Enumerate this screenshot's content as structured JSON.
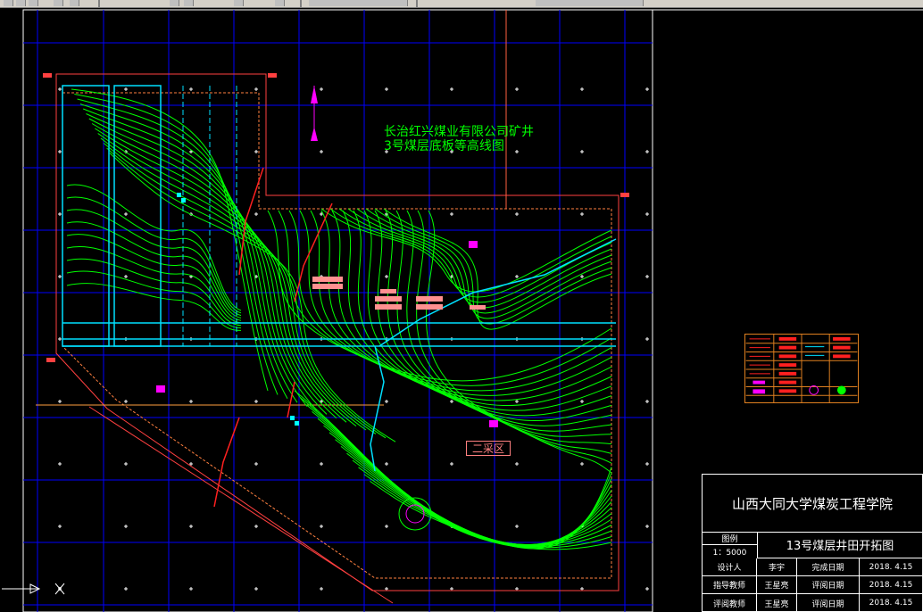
{
  "toolbar": {
    "buttons": [
      "new-icon",
      "open-icon",
      "save-icon",
      "undo-icon",
      "redo-icon",
      "pan-icon",
      "zoom-icon",
      "layer-icon",
      "properties-icon",
      "match-icon"
    ]
  },
  "map": {
    "title_line1": "长治红兴煤业有限公司矿井",
    "title_line2": "3号煤层底板等高线图",
    "area_label": "二采区"
  },
  "title_block": {
    "school": "山西大同大学煤炭工程学院",
    "legend_label": "图例",
    "scale": "1：5000",
    "drawing_title": "13号煤层井田开拓图",
    "rows": [
      {
        "role": "设计人",
        "name": "李宇",
        "date_label": "完成日期",
        "date": "2018. 4.15"
      },
      {
        "role": "指导教师",
        "name": "王星亮",
        "date_label": "评阅日期",
        "date": "2018. 4.15"
      },
      {
        "role": "评阅教师",
        "name": "王星亮",
        "date_label": "评阅日期",
        "date": "2018. 4.15"
      }
    ]
  },
  "colors": {
    "background": "#000000",
    "grid": "#0000ff",
    "contour": "#00ff00",
    "boundary": "#ff4040",
    "roadway": "#00e0ff",
    "text": "#ffffff"
  }
}
